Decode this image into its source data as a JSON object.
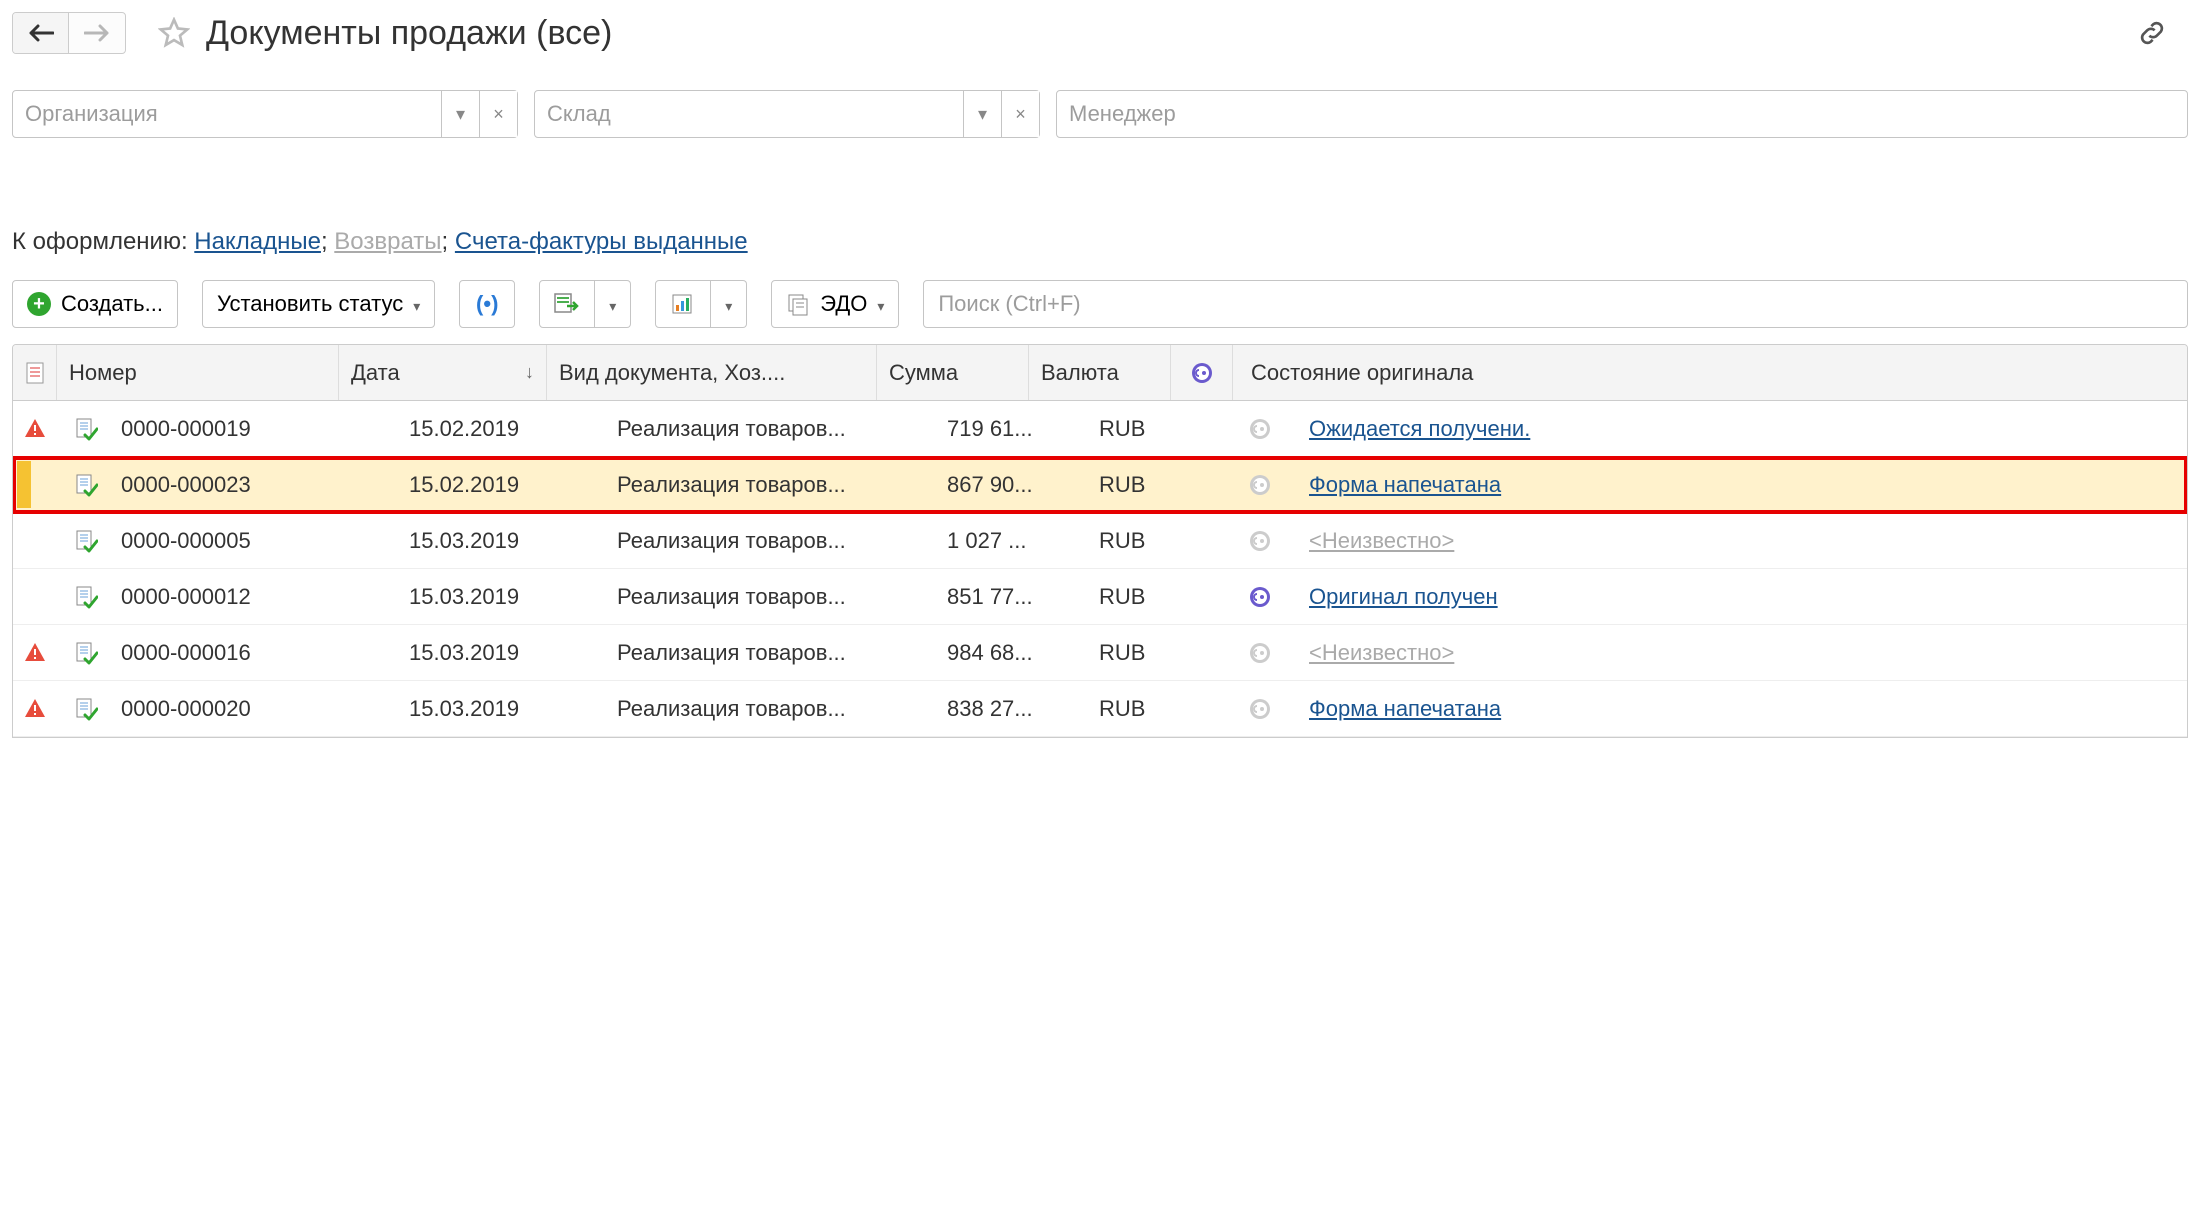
{
  "header": {
    "title": "Документы продажи (все)"
  },
  "filters": {
    "org_placeholder": "Организация",
    "warehouse_placeholder": "Склад",
    "manager_placeholder": "Менеджер"
  },
  "to_formalize": {
    "prefix": "К оформлению:",
    "links": [
      {
        "label": "Накладные",
        "enabled": true
      },
      {
        "label": "Возвраты",
        "enabled": false
      },
      {
        "label": "Счета-фактуры выданные",
        "enabled": true
      }
    ]
  },
  "toolbar": {
    "create_label": "Создать...",
    "set_status_label": "Установить статус",
    "edo_label": "ЭДО"
  },
  "search": {
    "placeholder": "Поиск (Ctrl+F)"
  },
  "columns": {
    "number": "Номер",
    "date": "Дата",
    "type": "Вид документа, Хоз....",
    "sum": "Сумма",
    "currency": "Валюта",
    "state": "Состояние оригинала"
  },
  "rows": [
    {
      "warn": true,
      "number": "0000-000019",
      "date": "15.02.2019",
      "type": "Реализация товаров...",
      "sum": "719 61...",
      "currency": "RUB",
      "flag": "gray",
      "state": "Ожидается получени.",
      "state_kind": "link",
      "selected": false
    },
    {
      "warn": false,
      "number": "0000-000023",
      "date": "15.02.2019",
      "type": "Реализация товаров...",
      "sum": "867 90...",
      "currency": "RUB",
      "flag": "gray",
      "state": "Форма напечатана",
      "state_kind": "link",
      "selected": true
    },
    {
      "warn": false,
      "number": "0000-000005",
      "date": "15.03.2019",
      "type": "Реализация товаров...",
      "sum": "1 027 ...",
      "currency": "RUB",
      "flag": "gray",
      "state": "<Неизвестно>",
      "state_kind": "unknown",
      "selected": false
    },
    {
      "warn": false,
      "number": "0000-000012",
      "date": "15.03.2019",
      "type": "Реализация товаров...",
      "sum": "851 77...",
      "currency": "RUB",
      "flag": "purple",
      "state": "Оригинал получен",
      "state_kind": "link",
      "selected": false
    },
    {
      "warn": true,
      "number": "0000-000016",
      "date": "15.03.2019",
      "type": "Реализация товаров...",
      "sum": "984 68...",
      "currency": "RUB",
      "flag": "gray",
      "state": "<Неизвестно>",
      "state_kind": "unknown",
      "selected": false
    },
    {
      "warn": true,
      "number": "0000-000020",
      "date": "15.03.2019",
      "type": "Реализация товаров...",
      "sum": "838 27...",
      "currency": "RUB",
      "flag": "gray",
      "state": "Форма напечатана",
      "state_kind": "link",
      "selected": false
    }
  ]
}
